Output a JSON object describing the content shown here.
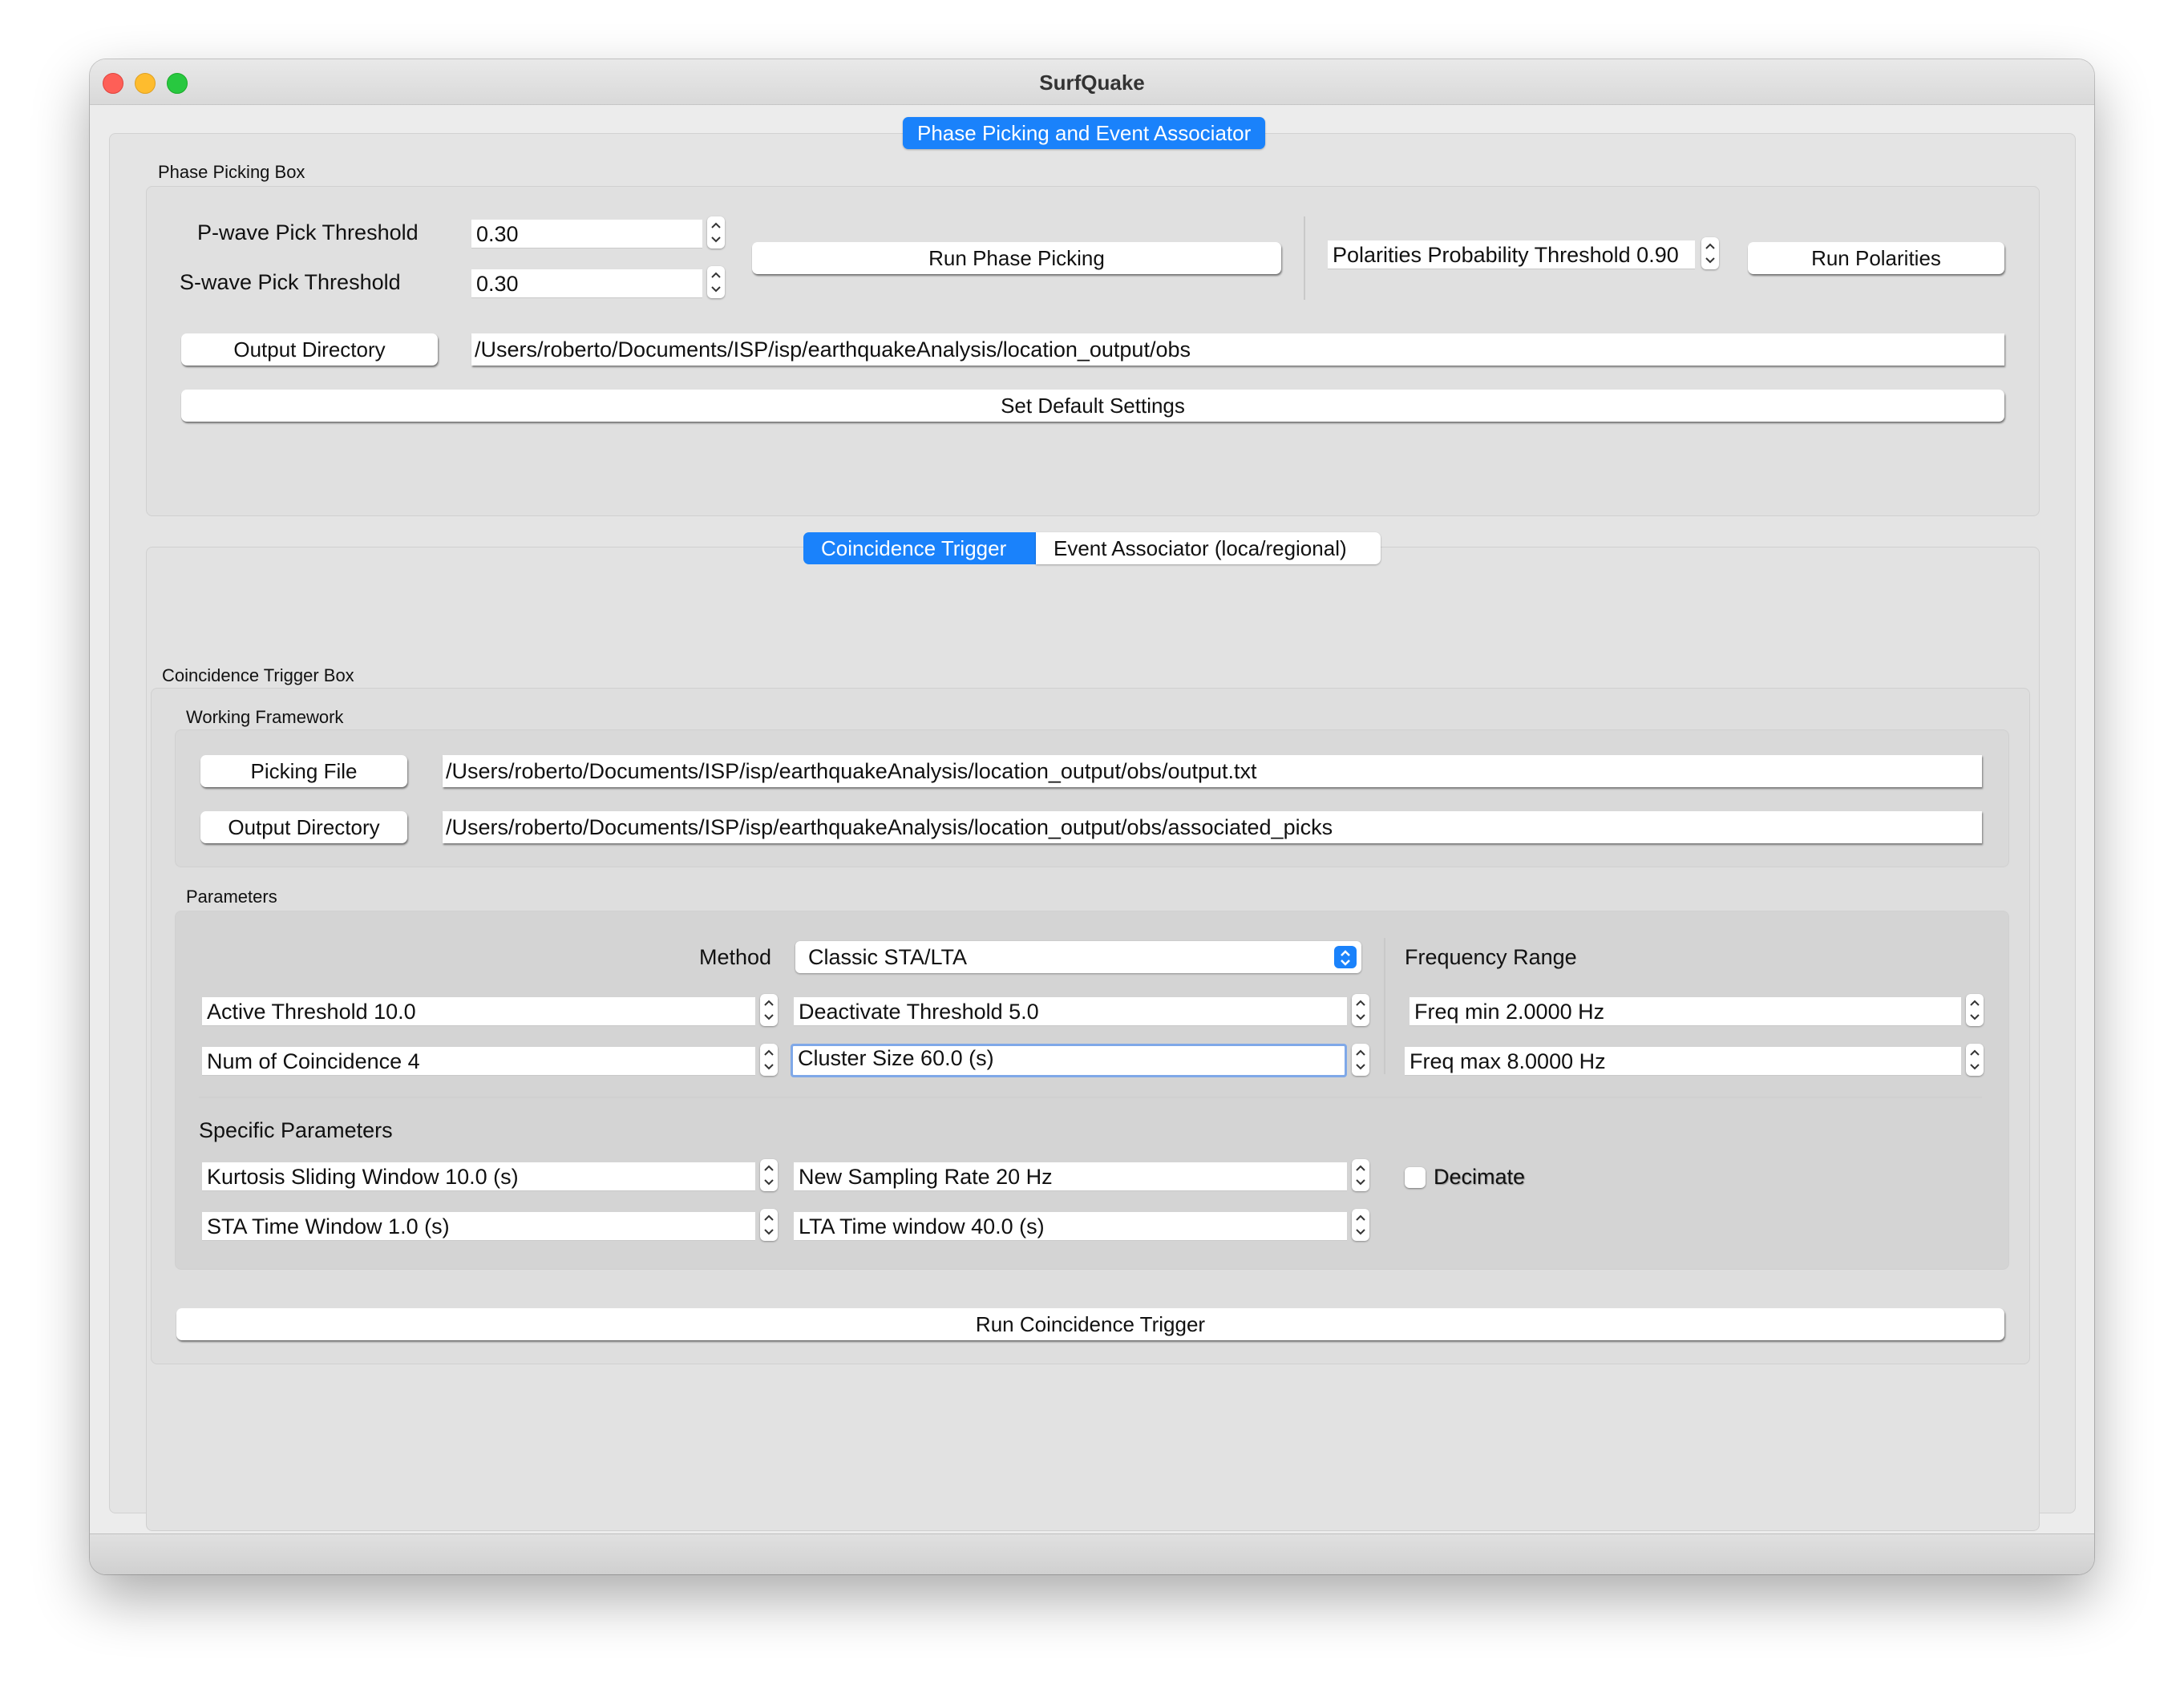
{
  "window": {
    "title": "SurfQuake"
  },
  "main_tab": {
    "label": "Phase Picking and Event Associator"
  },
  "phase_picking": {
    "title": "Phase Picking Box",
    "p_label": "P-wave Pick Threshold",
    "p_value": "0.30",
    "s_label": "S-wave Pick Threshold",
    "s_value": "0.30",
    "run_button": "Run Phase Picking",
    "polarities_field": "Polarities Probability Threshold 0.90",
    "polarities_button": "Run Polarities",
    "output_dir_button": "Output Directory",
    "output_dir_value": "/Users/roberto/Documents/ISP/isp/earthquakeAnalysis/location_output/obs",
    "default_button": "Set Default Settings"
  },
  "sub_tabs": [
    {
      "label": "Coincidence Trigger",
      "active": true
    },
    {
      "label": "Event Associator (loca/regional)",
      "active": false
    }
  ],
  "coincidence": {
    "box_title": "Coincidence Trigger Box",
    "working_title": "Working Framework",
    "picking_file_button": "Picking File",
    "picking_file_value": "/Users/roberto/Documents/ISP/isp/earthquakeAnalysis/location_output/obs/output.txt",
    "output_dir_button": "Output Directory",
    "output_dir_value": "/Users/roberto/Documents/ISP/isp/earthquakeAnalysis/location_output/obs/associated_picks",
    "params_title": "Parameters",
    "method_label": "Method",
    "method_value": "Classic STA/LTA",
    "freq_range_label": "Frequency Range",
    "active_threshold": "Active Threshold 10.0",
    "deactivate_threshold": "Deactivate Threshold 5.0",
    "freq_min": "Freq min 2.0000 Hz",
    "num_coincidence": "Num of Coincidence 4",
    "cluster_size": "Cluster Size 60.0 (s)",
    "freq_max": "Freq max 8.0000 Hz",
    "specific_title": "Specific Parameters",
    "kurtosis_window": "Kurtosis Sliding Window 10.0 (s)",
    "new_sampling_rate": "New Sampling Rate 20 Hz",
    "decimate_label": "Decimate",
    "decimate_checked": false,
    "sta_window": "STA Time Window 1.0 (s)",
    "lta_window": "LTA Time window 40.0 (s)",
    "run_button": "Run Coincidence Trigger"
  },
  "colors": {
    "accent": "#1a82fb"
  }
}
